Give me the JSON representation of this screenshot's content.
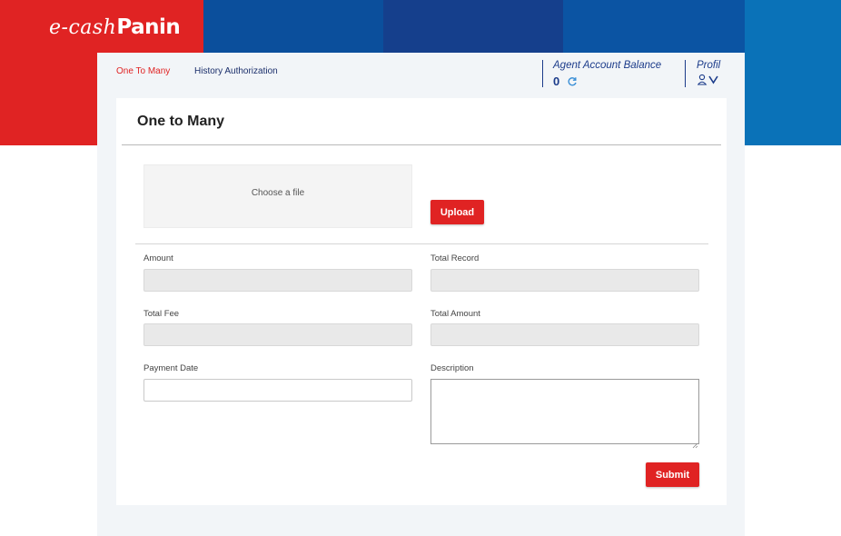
{
  "brand": {
    "logo_script": "e-cash",
    "logo_bold": "Panin",
    "colors": {
      "red": "#e02323",
      "blue": "#0b4f9c",
      "navy": "#1b3b8a",
      "sky": "#0a72b8"
    }
  },
  "nav": {
    "tabs": [
      {
        "label": "One To Many",
        "active": true
      },
      {
        "label": "History Authorization",
        "active": false
      }
    ]
  },
  "account": {
    "balance_label": "Agent Account Balance",
    "balance_value": "0",
    "refresh_icon": "refresh-icon",
    "profile_label": "Profil",
    "profile_icons": [
      "user-icon",
      "chevron-down-icon"
    ]
  },
  "page": {
    "title": "One to Many",
    "file_drop_label": "Choose a file",
    "upload_label": "Upload",
    "submit_label": "Submit"
  },
  "form": {
    "amount": {
      "label": "Amount",
      "value": ""
    },
    "total_record": {
      "label": "Total Record",
      "value": ""
    },
    "total_fee": {
      "label": "Total Fee",
      "value": ""
    },
    "total_amount": {
      "label": "Total Amount",
      "value": ""
    },
    "payment_date": {
      "label": "Payment Date",
      "value": ""
    },
    "description": {
      "label": "Description",
      "value": ""
    }
  }
}
